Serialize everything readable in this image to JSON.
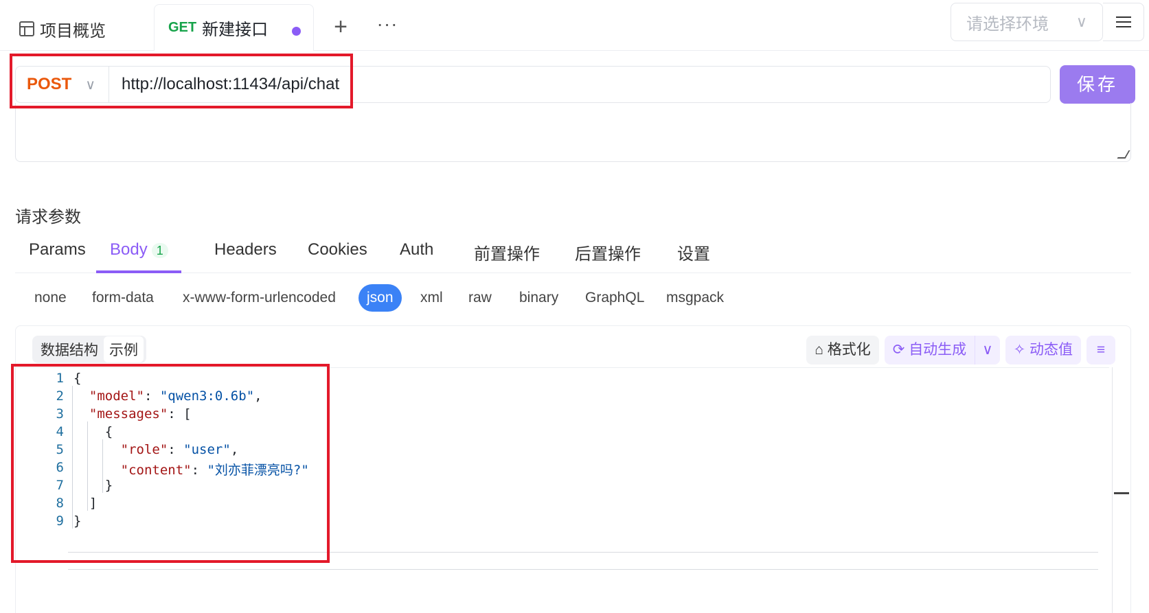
{
  "tabs": {
    "overview_label": "项目概览",
    "active_method": "GET",
    "active_label": "新建接口",
    "add_symbol": "+",
    "more_symbol": "···"
  },
  "env": {
    "placeholder": "请选择环境"
  },
  "request": {
    "method": "POST",
    "url": "http://localhost:11434/api/chat",
    "save_label": "保存"
  },
  "params": {
    "title": "请求参数",
    "tabs": [
      "Params",
      "Body",
      "Headers",
      "Cookies",
      "Auth",
      "前置操作",
      "后置操作",
      "设置"
    ],
    "body_badge": "1",
    "active_tab": "Body"
  },
  "body_types": [
    "none",
    "form-data",
    "x-www-form-urlencoded",
    "json",
    "xml",
    "raw",
    "binary",
    "GraphQL",
    "msgpack"
  ],
  "body_active": "json",
  "editor": {
    "segments": [
      "数据结构",
      "示例"
    ],
    "active_segment": "示例",
    "tools": {
      "format": "格式化",
      "autogen": "自动生成",
      "dynamic": "动态值"
    },
    "line_numbers": [
      "1",
      "2",
      "3",
      "4",
      "5",
      "6",
      "7",
      "8",
      "9"
    ],
    "code": {
      "model_key": "\"model\"",
      "model_val": "\"qwen3:0.6b\"",
      "messages_key": "\"messages\"",
      "role_key": "\"role\"",
      "role_val": "\"user\"",
      "content_key": "\"content\"",
      "content_val": "\"刘亦菲漂亮吗?\""
    }
  },
  "colors": {
    "accent": "#8b5cf6",
    "post": "#ea580c",
    "get": "#16a34a",
    "json_pill": "#3b82f6",
    "highlight": "#e3192a"
  }
}
